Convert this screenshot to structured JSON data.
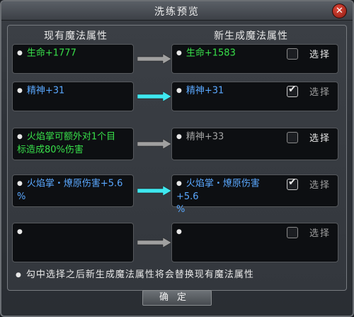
{
  "window": {
    "title": "洗练预览",
    "close_symbol": "✕"
  },
  "headers": {
    "current": "现有魔法属性",
    "new": "新生成魔法属性"
  },
  "rows": [
    {
      "current": "生命+1777",
      "current_color": "green",
      "new": "生命+1583",
      "new_color": "green",
      "checked": false,
      "select_label": "选择",
      "arrow": "gray"
    },
    {
      "current": "精神+31",
      "current_color": "blue",
      "new": "精神+31",
      "new_color": "blue",
      "checked": true,
      "select_label": "选择",
      "arrow": "cyan"
    },
    {
      "current": "火焰掌可额外对1个目\n标造成80%伤害",
      "current_color": "green",
      "new": "精神+33",
      "new_color": "gray",
      "checked": false,
      "select_label": "选择",
      "arrow": "gray"
    },
    {
      "current": "火焰掌・燎原伤害+5.6\n%",
      "current_color": "blue",
      "new": "火焰掌・燎原伤害+5.6\n%",
      "new_color": "blue",
      "checked": true,
      "select_label": "选择",
      "arrow": "cyan"
    },
    {
      "current": "",
      "current_color": "white",
      "new": "",
      "new_color": "white",
      "checked": false,
      "select_label": "选择",
      "arrow": "gray"
    }
  ],
  "footer_note": "勾中选择之后新生成魔法属性将会替换现有魔法属性",
  "confirm_label": "确定",
  "colors": {
    "green": "#38e04a",
    "blue": "#5aa8ff",
    "arrow_gray": "#a0a0a0",
    "arrow_cyan": "#3fe8f0"
  }
}
